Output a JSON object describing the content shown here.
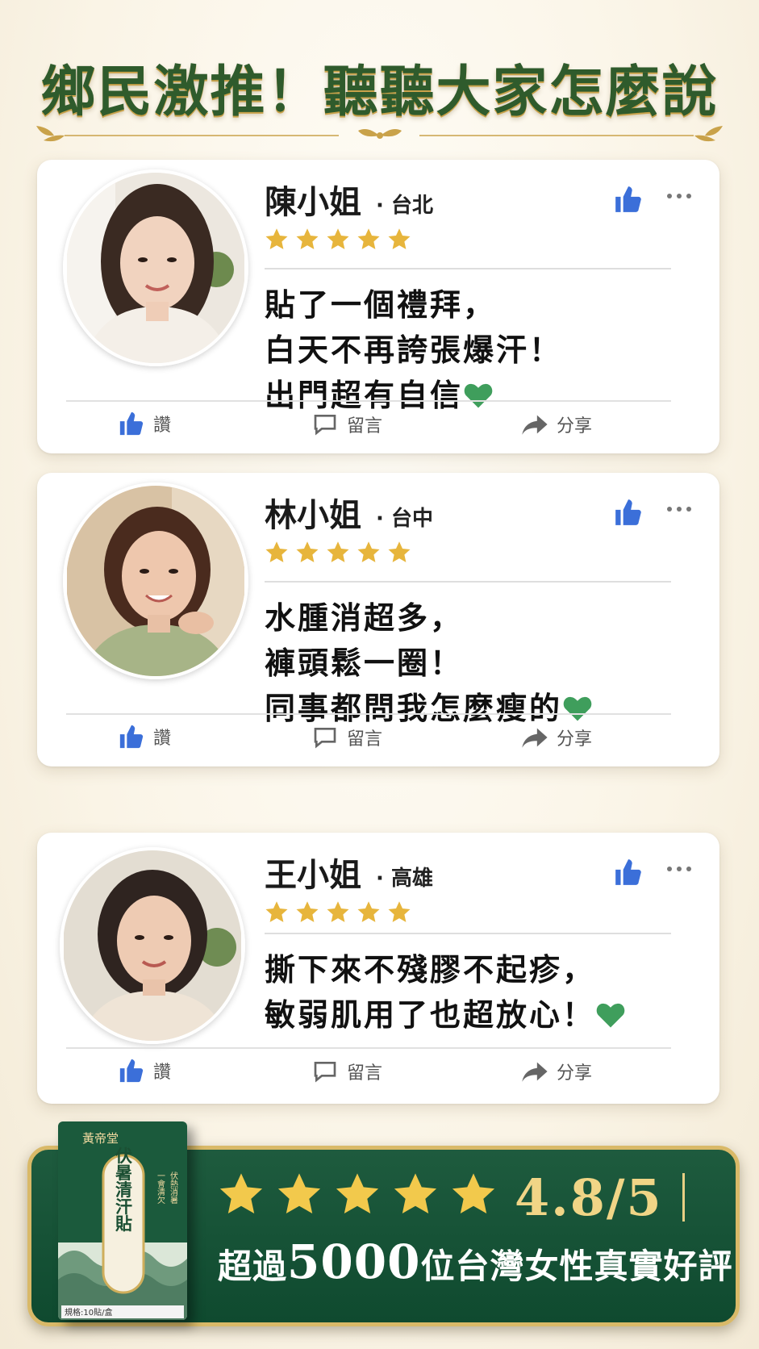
{
  "header": {
    "title": "鄉民激推！聽聽大家怎麼說"
  },
  "reviews": [
    {
      "name": "陳小姐",
      "city": "台北",
      "rating": 5,
      "lines": [
        "貼了一個禮拜，",
        "白天不再誇張爆汗！",
        "出門超有自信"
      ]
    },
    {
      "name": "林小姐",
      "city": "台中",
      "rating": 5,
      "lines": [
        "水腫消超多，",
        "褲頭鬆一圈！",
        "同事都問我怎麼瘦的"
      ]
    },
    {
      "name": "王小姐",
      "city": "高雄",
      "rating": 5,
      "lines": [
        "撕下來不殘膠不起疹，",
        "敏弱肌用了也超放心！"
      ]
    }
  ],
  "actions": {
    "like": "讚",
    "comment": "留言",
    "share": "分享"
  },
  "summary": {
    "rating": "4.8/5",
    "text_before": "超過",
    "count": "5000",
    "text_after": "位台灣女性真實好評",
    "stars": 5
  },
  "product": {
    "brand": "黃帝堂",
    "name": "伏暑清汗貼",
    "side_left": "一會清欠",
    "side_right": "伏熱消暑",
    "quantity": "規格:10貼/盒"
  },
  "colors": {
    "banner_green": "#0f4a2f",
    "gold": "#d9b968",
    "star": "#e7b53c",
    "facebook_blue": "#3b6fd9",
    "heart_green": "#3f9e5c"
  }
}
